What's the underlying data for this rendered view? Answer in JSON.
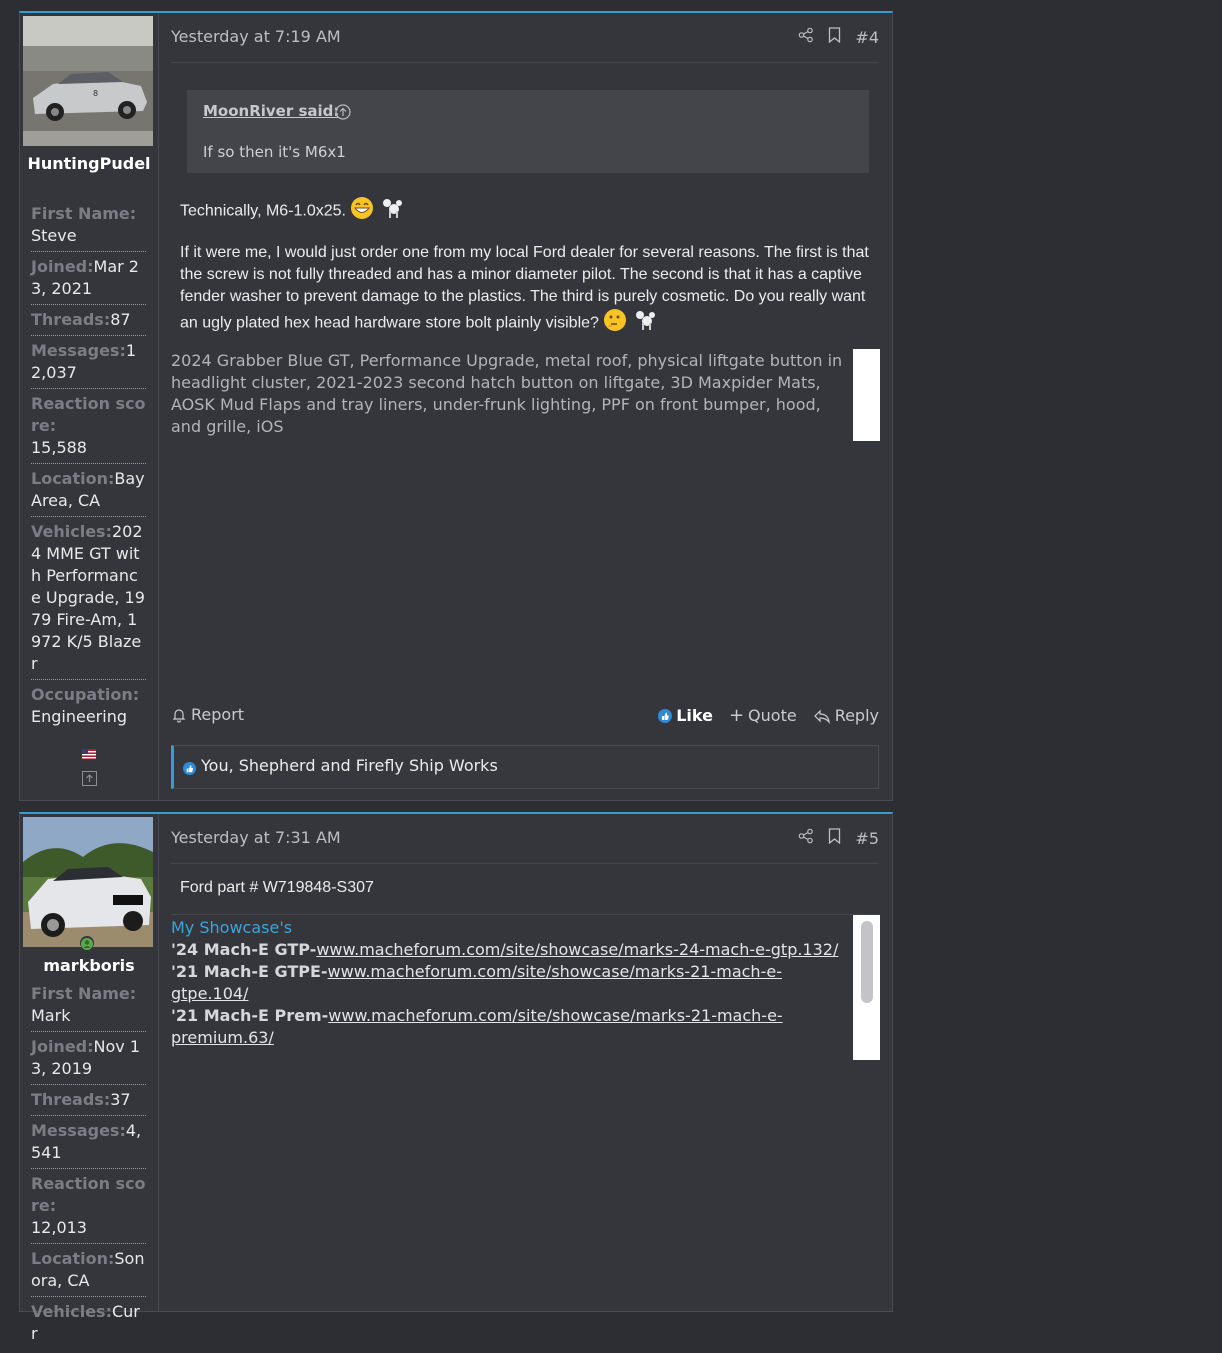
{
  "posts": [
    {
      "user": {
        "name": "HuntingPudel",
        "stats": [
          {
            "key": "First Name:",
            "val": "Steve"
          },
          {
            "key": "Joined:",
            "val": "Mar 23, 2021"
          },
          {
            "key": "Threads:",
            "val": "87"
          },
          {
            "key": "Messages:",
            "val": "12,037"
          },
          {
            "key": "Reaction score:",
            "val": "15,588"
          },
          {
            "key": "Location:",
            "val": "Bay Area, CA"
          },
          {
            "key": "Vehicles:",
            "val": "2024 MME GT with Performance Upgrade, 1979 Fire-Am, 1972 K/5 Blazer"
          },
          {
            "key": "Occupation:",
            "val": "Engineering"
          }
        ]
      },
      "date": "Yesterday at 7:19 AM",
      "number": "#4",
      "quote": {
        "author": "MoonRiver said:",
        "text": "If so then it's M6x1"
      },
      "message": [
        "Technically, M6-1.0x25.",
        "If it were me, I would just order one from my local Ford dealer for several reasons. The first is that the screw is not fully threaded and has a minor diameter pilot. The second is that it has a captive fender washer to prevent damage to the plastics. The third is purely cosmetic. Do you really want an ugly plated hex head hardware store bolt plainly visible?"
      ],
      "signature": "2024 Grabber Blue GT, Performance Upgrade, metal roof, physical liftgate button in headlight cluster, 2021-2023 second hatch button on liftgate, 3D Maxpider Mats, AOSK Mud Flaps and tray liners, under-frunk lighting, PPF on front bumper, hood, and grille, iOS",
      "actions": {
        "report": "Report",
        "like": "Like",
        "quote": "Quote",
        "reply": "Reply"
      },
      "likes": "You, Shepherd and Firefly Ship Works"
    },
    {
      "user": {
        "name": "markboris",
        "stats": [
          {
            "key": "First Name:",
            "val": "Mark"
          },
          {
            "key": "Joined:",
            "val": "Nov 13, 2019"
          },
          {
            "key": "Threads:",
            "val": "37"
          },
          {
            "key": "Messages:",
            "val": "4,541"
          },
          {
            "key": "Reaction score:",
            "val": "12,013"
          },
          {
            "key": "Location:",
            "val": "Sonora, CA"
          },
          {
            "key": "Vehicles:",
            "val": "Curr"
          }
        ]
      },
      "date": "Yesterday at 7:31 AM",
      "number": "#5",
      "message": [
        "Ford part # W719848-S307"
      ],
      "signature": {
        "title": "My Showcase's",
        "lines": [
          {
            "label": "'24 Mach-E GTP-",
            "link": "www.macheforum.com/site/showcase/marks-24-mach-e-gtp.132/"
          },
          {
            "label": "'21 Mach-E GTPE-",
            "link": "www.macheforum.com/site/showcase/marks-21-mach-e-gtpe.104/"
          },
          {
            "label": "'21 Mach-E Prem-",
            "link": "www.macheforum.com/site/showcase/marks-21-mach-e-premium.63/"
          }
        ]
      }
    }
  ],
  "colors": {
    "accent": "#2f9fd6",
    "background": "#2d2e33",
    "panel": "#35363c"
  }
}
